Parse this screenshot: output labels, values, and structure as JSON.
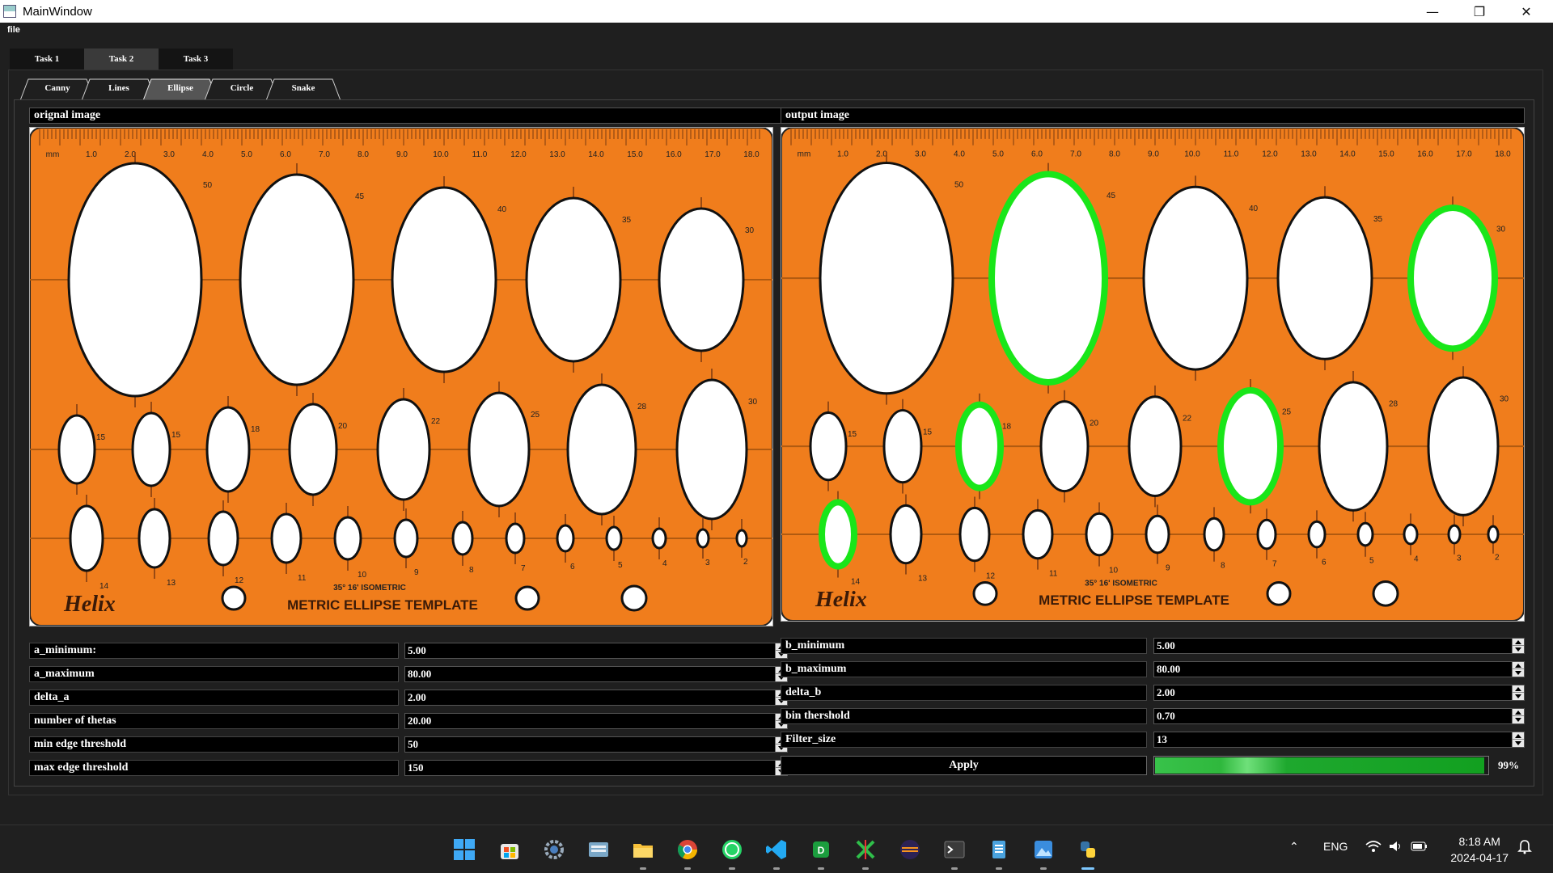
{
  "window": {
    "title": "MainWindow",
    "minimize": "—",
    "maximize": "❐",
    "close": "✕"
  },
  "menu": {
    "file": "file"
  },
  "tabs": [
    {
      "label": "Task 1",
      "active": false
    },
    {
      "label": "Task 2",
      "active": true
    },
    {
      "label": "Task 3",
      "active": false
    }
  ],
  "subtabs": [
    {
      "label": "Canny",
      "active": false
    },
    {
      "label": "Lines",
      "active": false
    },
    {
      "label": "Ellipse",
      "active": true
    },
    {
      "label": "Circle",
      "active": false
    },
    {
      "label": "Snake",
      "active": false
    }
  ],
  "panels": {
    "original_label": "orignal image",
    "output_label": "output image"
  },
  "template_image": {
    "brand": "Helix",
    "title": "METRIC ELLIPSE TEMPLATE",
    "subtitle": "35° 16' ISOMETRIC",
    "scale_ticks": [
      "mm",
      "1.0",
      "2.0",
      "3.0",
      "4.0",
      "5.0",
      "6.0",
      "7.0",
      "8.0",
      "9.0",
      "10.0",
      "11.0",
      "12.0",
      "13.0",
      "14.0",
      "15.0",
      "16.0",
      "17.0",
      "18.0"
    ],
    "row1_sizes": [
      "50",
      "45",
      "40",
      "35",
      "30"
    ],
    "row2_sizes": [
      "15",
      "15",
      "18",
      "20",
      "22",
      "25",
      "28",
      "30"
    ],
    "row3_sizes": [
      "14",
      "13",
      "12",
      "11",
      "10",
      "9",
      "8",
      "7",
      "6",
      "5",
      "4",
      "3",
      "2"
    ],
    "colors": {
      "plate": "#f07d1c",
      "ellipse": "#ffffff",
      "outline": "#111111",
      "detected": "#19e619"
    }
  },
  "params_left": [
    {
      "label": "a_minimum:",
      "value": "5.00"
    },
    {
      "label": "a_maximum",
      "value": "80.00"
    },
    {
      "label": "delta_a",
      "value": "2.00"
    },
    {
      "label": "number of thetas",
      "value": "20.00"
    },
    {
      "label": "min edge threshold",
      "value": "50"
    },
    {
      "label": "max edge threshold",
      "value": "150"
    }
  ],
  "params_right": [
    {
      "label": "b_minimum",
      "value": "5.00"
    },
    {
      "label": "b_maximum",
      "value": "80.00"
    },
    {
      "label": "delta_b",
      "value": "2.00"
    },
    {
      "label": "bin thershold",
      "value": "0.70"
    },
    {
      "label": "Filter_size",
      "value": "13"
    }
  ],
  "apply_label": "Apply",
  "progress": {
    "value": 0.99,
    "text": "99%"
  },
  "taskbar": {
    "apps": [
      "windows-start",
      "store",
      "settings",
      "keyboard-app",
      "file-explorer",
      "chrome",
      "whatsapp",
      "vscode",
      "d-app",
      "x-app",
      "eclipse",
      "terminal",
      "notepad",
      "photos",
      "python"
    ],
    "tray": {
      "lang": "ENG",
      "time": "8:18 AM",
      "date": "2024-04-17"
    }
  }
}
